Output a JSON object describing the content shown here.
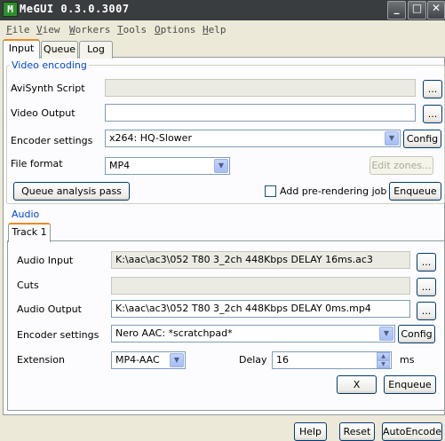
{
  "window": {
    "title": "MeGUI 0.3.0.3007",
    "icon_text": "M",
    "buttons": {
      "minimize": "_",
      "maximize": "□",
      "close": "✕"
    }
  },
  "menu": [
    {
      "label": "File",
      "underline": "F",
      "rest": "ile"
    },
    {
      "label": "View",
      "underline": "V",
      "rest": "iew"
    },
    {
      "label": "Workers",
      "underline": "W",
      "rest": "orkers"
    },
    {
      "label": "Tools",
      "underline": "T",
      "rest": "ools"
    },
    {
      "label": "Options",
      "underline": "O",
      "rest": "ptions"
    },
    {
      "label": "Help",
      "underline": "H",
      "rest": "elp"
    }
  ],
  "tabs": [
    "Input",
    "Queue",
    "Log"
  ],
  "video": {
    "group_title": "Video encoding",
    "avisynth_label": "AviSynth Script",
    "avisynth_value": "",
    "output_label": "Video Output",
    "output_value": "",
    "encoder_label": "Encoder settings",
    "encoder_value": "x264: HQ-Slower",
    "config_label": "Config",
    "format_label": "File format",
    "format_value": "MP4",
    "edit_zones_label": "Edit zones...",
    "queue_analysis_label": "Queue analysis pass",
    "prerender_label": "Add pre-rendering job",
    "enqueue_label": "Enqueue",
    "browse_label": "..."
  },
  "audio": {
    "group_title": "Audio",
    "track_tab": "Track 1",
    "input_label": "Audio Input",
    "input_value": "K:\\aac\\ac3\\052 T80 3_2ch 448Kbps DELAY 16ms.ac3",
    "cuts_label": "Cuts",
    "cuts_value": "",
    "output_label": "Audio Output",
    "output_value": "K:\\aac\\ac3\\052 T80 3_2ch 448Kbps DELAY 0ms.mp4",
    "encoder_label": "Encoder settings",
    "encoder_value": "Nero AAC: *scratchpad*",
    "config_label": "Config",
    "extension_label": "Extension",
    "extension_value": "MP4-AAC",
    "delay_label": "Delay",
    "delay_value": "16",
    "delay_unit": "ms",
    "clear_label": "X",
    "enqueue_label": "Enqueue",
    "browse_label": "..."
  },
  "footer": {
    "help_label": "Help",
    "reset_label": "Reset",
    "autoencode_label": "AutoEncode"
  }
}
